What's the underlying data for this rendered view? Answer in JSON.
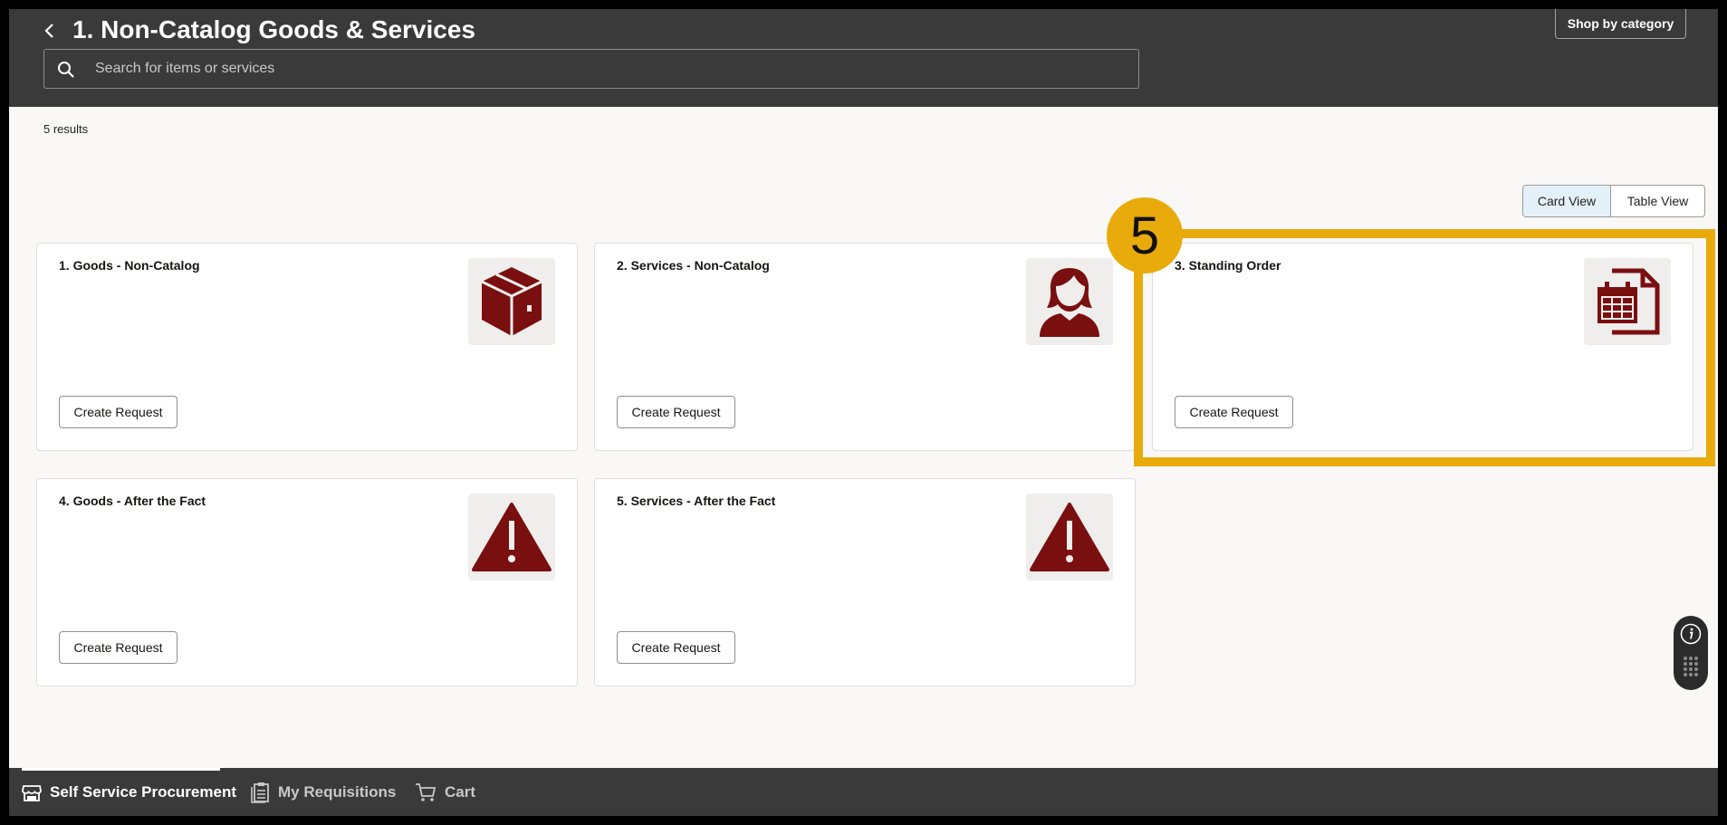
{
  "header": {
    "title": "1. Non-Catalog Goods & Services",
    "shop_by_category_label": "Shop by category",
    "search_placeholder": "Search for items or services",
    "search_value": ""
  },
  "results": {
    "count_label": "5 results"
  },
  "view_toggle": {
    "card_view_label": "Card View",
    "table_view_label": "Table View",
    "selected": "Card View"
  },
  "cards": [
    {
      "title": "1. Goods - Non-Catalog",
      "icon": "package-icon",
      "button_label": "Create Request"
    },
    {
      "title": "2. Services - Non-Catalog",
      "icon": "person-icon",
      "button_label": "Create Request"
    },
    {
      "title": "3. Standing Order",
      "icon": "calendar-document-icon",
      "button_label": "Create Request"
    },
    {
      "title": "4. Goods - After the Fact",
      "icon": "warning-icon",
      "button_label": "Create Request"
    },
    {
      "title": "5. Services - After the Fact",
      "icon": "warning-icon",
      "button_label": "Create Request"
    }
  ],
  "annotation": {
    "step_number": "5",
    "highlight_color": "#e8ab0b"
  },
  "bottom_nav": {
    "items": [
      {
        "label": "Self Service Procurement",
        "icon": "store-icon",
        "active": true
      },
      {
        "label": "My Requisitions",
        "icon": "clipboard-icon",
        "active": false
      },
      {
        "label": "Cart",
        "icon": "cart-icon",
        "active": false
      }
    ]
  },
  "colors": {
    "header_bg": "#3a3a3a",
    "icon_maroon": "#7a0f0f",
    "page_bg": "#f9f8f6",
    "toggle_selected_bg": "#e4f0f8"
  }
}
